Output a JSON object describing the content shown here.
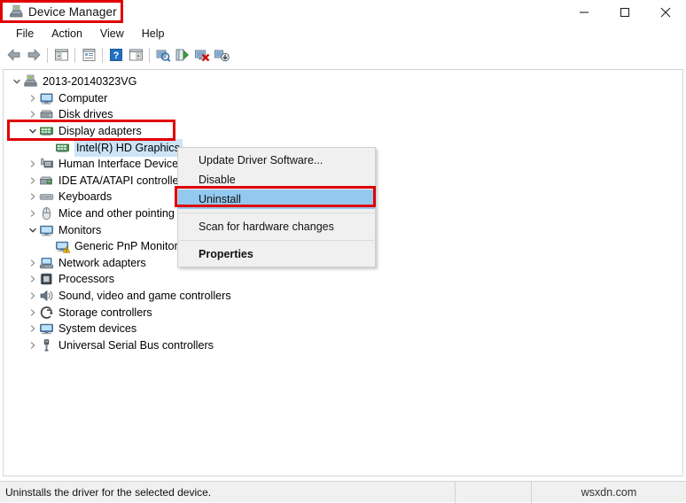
{
  "window": {
    "title": "Device Manager",
    "title_icon": "device-manager-icon",
    "controls": {
      "minimize": "minimize-icon",
      "maximize": "maximize-icon",
      "close": "close-icon"
    },
    "highlight_color": "#e00000"
  },
  "menubar": {
    "items": [
      "File",
      "Action",
      "View",
      "Help"
    ]
  },
  "toolbar": {
    "buttons": [
      {
        "name": "back-icon",
        "title": "Back"
      },
      {
        "name": "forward-icon",
        "title": "Forward"
      },
      {
        "name": "show-hide-console-tree-icon",
        "title": "Show/Hide Console Tree"
      },
      {
        "name": "properties-icon",
        "title": "Properties"
      },
      {
        "name": "help-icon",
        "title": "Help"
      },
      {
        "name": "show-hide-action-pane-icon",
        "title": "Show/Hide Action Pane"
      },
      {
        "name": "scan-for-hardware-changes-icon",
        "title": "Scan for hardware changes"
      },
      {
        "name": "update-driver-software-icon",
        "title": "Update Driver Software"
      },
      {
        "name": "disable-device-icon",
        "title": "Disable"
      },
      {
        "name": "uninstall-device-icon",
        "title": "Uninstall"
      }
    ]
  },
  "tree": {
    "root": {
      "label": "2013-20140323VG",
      "icon": "computer-root-icon",
      "expanded": true
    },
    "nodes": [
      {
        "label": "Computer",
        "icon": "computer-icon",
        "state": "collapsed",
        "depth": 1
      },
      {
        "label": "Disk drives",
        "icon": "disk-drive-icon",
        "state": "collapsed",
        "depth": 1
      },
      {
        "label": "Display adapters",
        "icon": "display-adapter-icon",
        "state": "expanded",
        "depth": 1,
        "highlighted": true
      },
      {
        "label": "Intel(R) HD Graphics",
        "icon": "display-adapter-icon",
        "state": "leaf",
        "depth": 2,
        "selected": true
      },
      {
        "label": "Human Interface Devices",
        "icon": "hid-icon",
        "state": "collapsed",
        "depth": 1
      },
      {
        "label": "IDE ATA/ATAPI controllers",
        "icon": "ide-controller-icon",
        "state": "collapsed",
        "depth": 1
      },
      {
        "label": "Keyboards",
        "icon": "keyboard-icon",
        "state": "collapsed",
        "depth": 1
      },
      {
        "label": "Mice and other pointing devices",
        "icon": "mouse-icon",
        "state": "collapsed",
        "depth": 1
      },
      {
        "label": "Monitors",
        "icon": "monitor-icon",
        "state": "expanded",
        "depth": 1
      },
      {
        "label": "Generic PnP Monitor",
        "icon": "monitor-warning-icon",
        "state": "leaf",
        "depth": 2
      },
      {
        "label": "Network adapters",
        "icon": "network-adapter-icon",
        "state": "collapsed",
        "depth": 1
      },
      {
        "label": "Processors",
        "icon": "processor-icon",
        "state": "collapsed",
        "depth": 1
      },
      {
        "label": "Sound, video and game controllers",
        "icon": "sound-icon",
        "state": "collapsed",
        "depth": 1
      },
      {
        "label": "Storage controllers",
        "icon": "storage-controller-icon",
        "state": "collapsed",
        "depth": 1
      },
      {
        "label": "System devices",
        "icon": "system-device-icon",
        "state": "collapsed",
        "depth": 1
      },
      {
        "label": "Universal Serial Bus controllers",
        "icon": "usb-controller-icon",
        "state": "collapsed",
        "depth": 1
      }
    ]
  },
  "context_menu": {
    "items": [
      {
        "label": "Update Driver Software...",
        "highlighted": false,
        "bold": false
      },
      {
        "label": "Disable",
        "highlighted": false,
        "bold": false
      },
      {
        "label": "Uninstall",
        "highlighted": true,
        "bold": false
      },
      {
        "label": "Scan for hardware changes",
        "highlighted": false,
        "bold": false
      },
      {
        "label": "Properties",
        "highlighted": false,
        "bold": true
      }
    ],
    "highlight_bg": "#93c9ef"
  },
  "statusbar": {
    "message": "Uninstalls the driver for the selected device.",
    "watermark": "wsxdn.com"
  }
}
